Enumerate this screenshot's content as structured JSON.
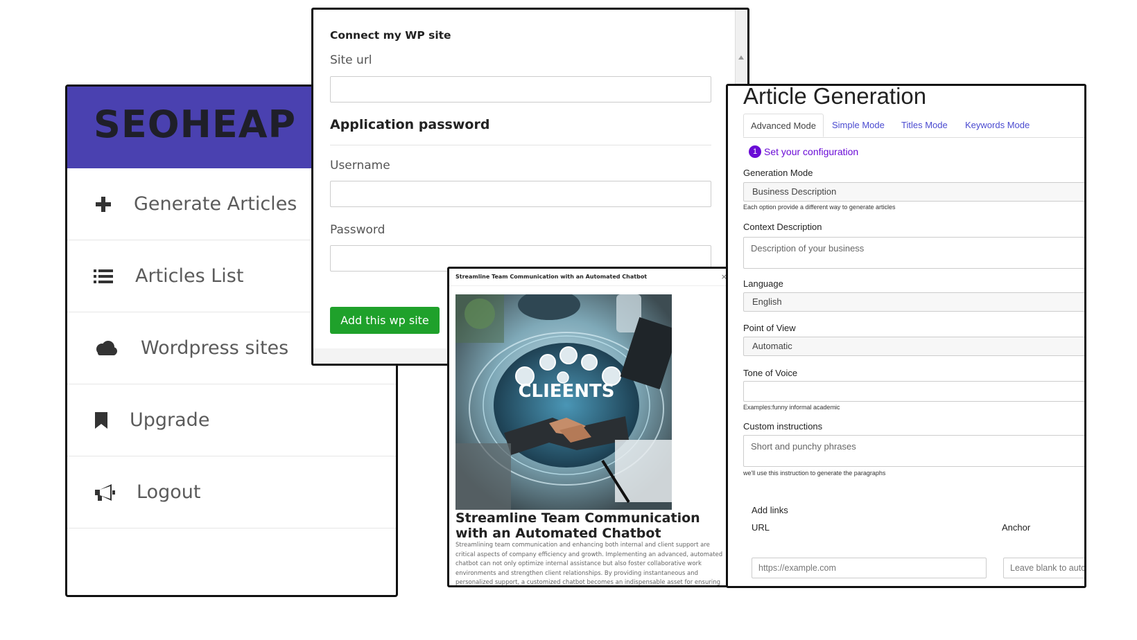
{
  "sidebar": {
    "brand": "SEOHEAP",
    "items": [
      {
        "label": "Generate Articles",
        "icon": "plus-icon"
      },
      {
        "label": "Articles List",
        "icon": "list-icon"
      },
      {
        "label": "Wordpress sites",
        "icon": "cloud-icon"
      },
      {
        "label": "Upgrade",
        "icon": "bookmark-icon"
      },
      {
        "label": "Logout",
        "icon": "megaphone-icon"
      }
    ],
    "brand_color": "#4a41b0"
  },
  "wp_form": {
    "title": "Connect my WP site",
    "site_url_label": "Site url",
    "site_url_value": "",
    "app_password_heading": "Application password",
    "username_label": "Username",
    "username_value": "",
    "password_label": "Password",
    "password_value": "",
    "submit_label": "Add this wp site",
    "button_color": "#1fa12b"
  },
  "article_preview": {
    "header_title": "Streamline Team Communication with an Automated Chatbot",
    "close": "×",
    "image_caption": "CLIEENTS",
    "title": "Streamline Team Communication with an Automated Chatbot",
    "body": "Streamlining team communication and enhancing both internal and client support are critical aspects of company efficiency and growth. Implementing an advanced, automated chatbot can not only optimize internal assistance but also foster collaborative work environments and strengthen client relationships. By providing instantaneous and personalized support, a customized chatbot becomes an indispensable asset for ensuring smooth operations and"
  },
  "generation": {
    "title": "Article Generation",
    "tabs": [
      "Advanced Mode",
      "Simple Mode",
      "Titles Mode",
      "Keywords Mode"
    ],
    "active_tab": "Advanced Mode",
    "step_number": "1",
    "step_label": "Set your configuration",
    "generation_mode_label": "Generation Mode",
    "generation_mode_value": "Business Description",
    "generation_mode_hint": "Each option provide a different way to generate articles",
    "context_label": "Context Description",
    "context_placeholder": "Description of your business",
    "language_label": "Language",
    "language_value": "English",
    "pov_label": "Point of View",
    "pov_value": "Automatic",
    "tone_label": "Tone of Voice",
    "tone_value": "",
    "tone_hint": "Examples:funny informal academic",
    "custom_label": "Custom instructions",
    "custom_placeholder": "Short and punchy phrases",
    "custom_hint": "we'll use this instruction to generate the paragraphs",
    "add_links_label": "Add links",
    "url_label": "URL",
    "url_placeholder": "https://example.com",
    "anchor_label": "Anchor",
    "anchor_placeholder": "Leave blank to auto",
    "accent_color": "#6a0bd6"
  }
}
